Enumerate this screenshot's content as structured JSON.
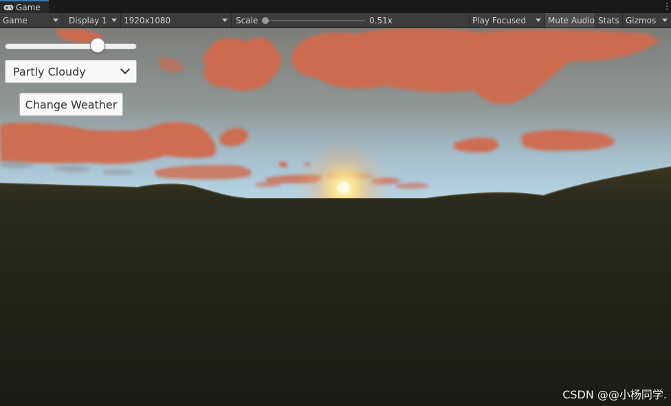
{
  "tab": {
    "label": "Game",
    "icon": "gamepad-icon"
  },
  "toolbar": {
    "mode": "Game",
    "display": "Display 1",
    "resolution": "1920x1080",
    "scale_label": "Scale",
    "scale_value": "0.51x",
    "scale_fraction": 0.51,
    "play_mode": "Play Focused",
    "mute_audio": "Mute Audio",
    "stats": "Stats",
    "gizmos": "Gizmos"
  },
  "game_ui": {
    "slider_value": 0.73,
    "dropdown_selected": "Partly Cloudy",
    "button_label": "Change Weather"
  },
  "watermark": "CSDN @@小杨同学.",
  "colors": {
    "tab_accent": "#3a79bb",
    "sky_top": "#7d7e7a",
    "sky_horizon": "#a9c6d6",
    "cloud": "#d46b4f",
    "sun": "#fff0a0",
    "ground": "#22231a"
  }
}
